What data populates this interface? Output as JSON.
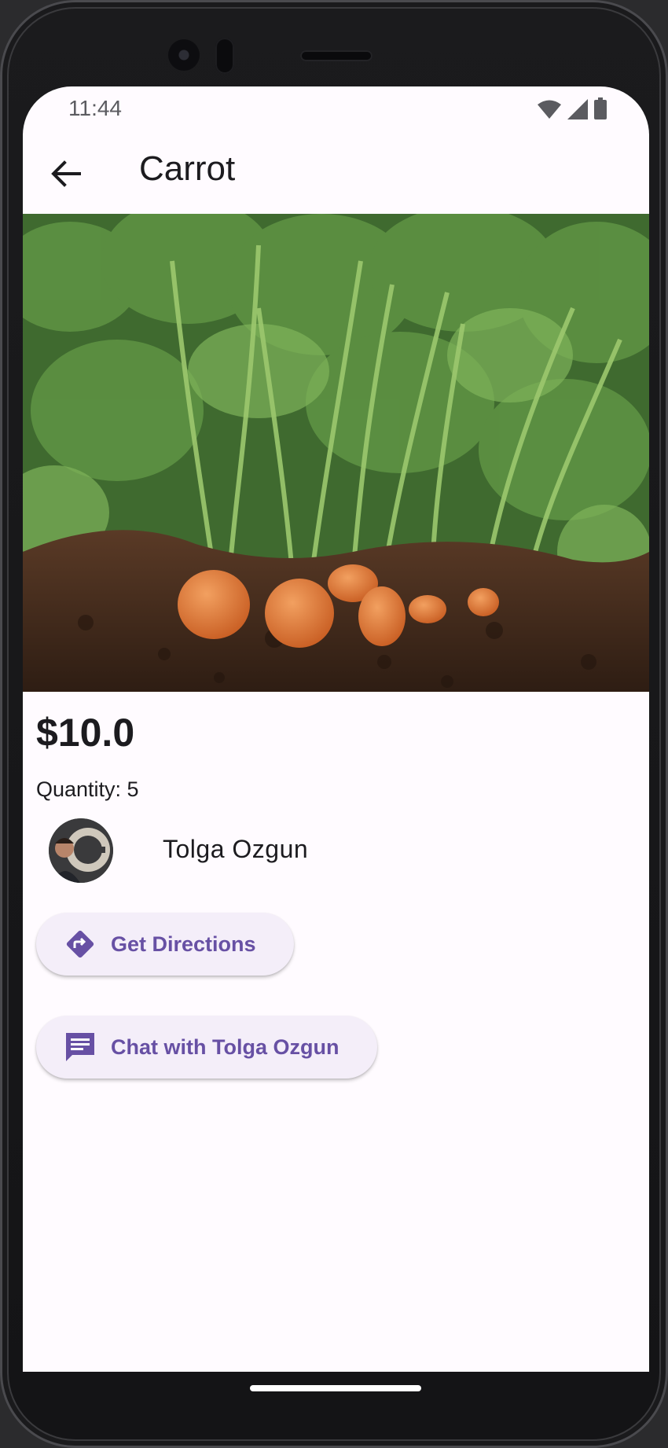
{
  "status": {
    "time": "11:44",
    "icons": [
      "wifi-icon",
      "cell-signal-icon",
      "battery-icon"
    ]
  },
  "appbar": {
    "back_icon": "arrow-left-icon",
    "title": "Carrot"
  },
  "product": {
    "image_subject": "carrots growing in soil",
    "price": "$10.0",
    "quantity_label": "Quantity: 5"
  },
  "seller": {
    "name": "Tolga Ozgun"
  },
  "actions": {
    "directions_label": "Get Directions",
    "directions_icon": "directions-icon",
    "chat_label": "Chat with Tolga Ozgun",
    "chat_icon": "chat-icon"
  },
  "colors": {
    "accent": "#6750a4",
    "button_bg": "#f4eef9",
    "surface": "#fffbff",
    "text": "#1c1b1f"
  }
}
